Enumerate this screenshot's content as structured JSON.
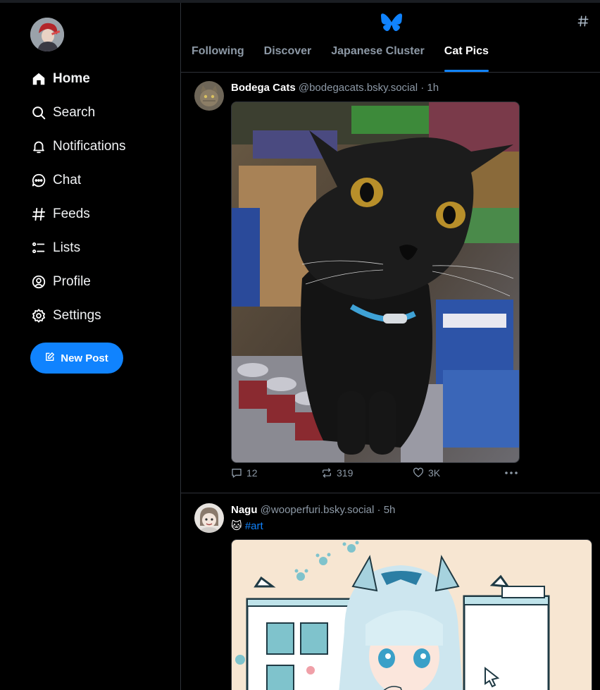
{
  "sidebar": {
    "items": [
      {
        "label": "Home",
        "icon": "home-icon"
      },
      {
        "label": "Search",
        "icon": "search-icon"
      },
      {
        "label": "Notifications",
        "icon": "bell-icon"
      },
      {
        "label": "Chat",
        "icon": "chat-icon"
      },
      {
        "label": "Feeds",
        "icon": "hash-icon"
      },
      {
        "label": "Lists",
        "icon": "list-icon"
      },
      {
        "label": "Profile",
        "icon": "profile-icon"
      },
      {
        "label": "Settings",
        "icon": "gear-icon"
      }
    ],
    "new_post_label": "New Post"
  },
  "header": {
    "tabs": [
      "Following",
      "Discover",
      "Japanese Cluster",
      "Cat Pics"
    ],
    "active_tab": "Cat Pics"
  },
  "posts": [
    {
      "name": "Bodega Cats",
      "handle": "@bodegacats.bsky.social",
      "time": "· 1h",
      "replies": "12",
      "reposts": "319",
      "likes": "3K"
    },
    {
      "name": "Nagu",
      "handle": "@wooperfuri.bsky.social",
      "time": "· 5h",
      "emoji": "🐱",
      "hashtag": "#art"
    }
  ],
  "colors": {
    "accent": "#1083fe",
    "background": "#000000",
    "muted": "#8d99a6",
    "border": "#2e3238"
  }
}
